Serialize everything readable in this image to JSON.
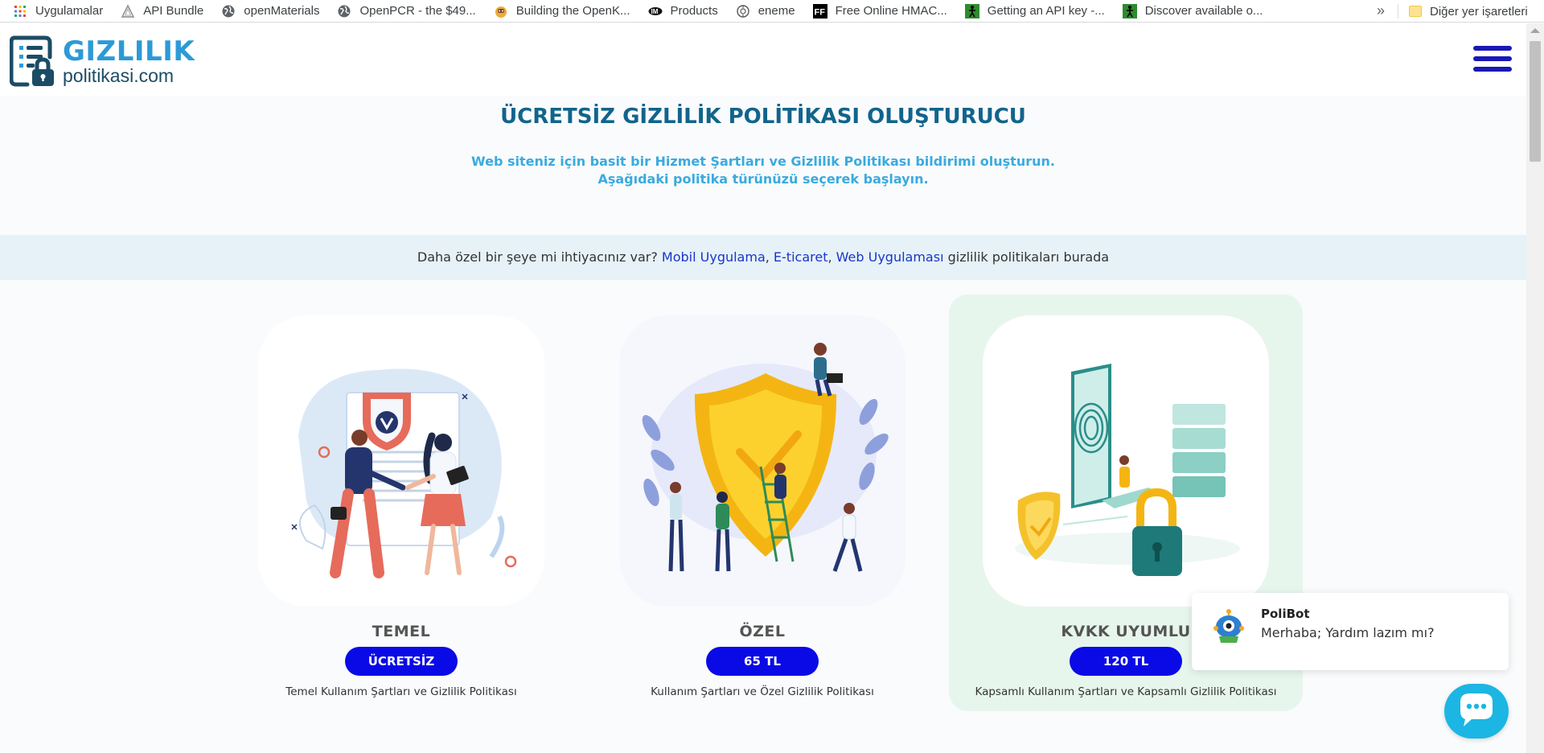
{
  "bookmarks": {
    "items": [
      {
        "label": "Uygulamalar",
        "icon": "apps-grid-icon"
      },
      {
        "label": "API Bundle",
        "icon": "triangle-logo-icon"
      },
      {
        "label": "openMaterials",
        "icon": "globe-icon"
      },
      {
        "label": "OpenPCR - the $49...",
        "icon": "globe-icon"
      },
      {
        "label": "Building the OpenK...",
        "icon": "maker-logo-icon"
      },
      {
        "label": "Products",
        "icon": "nordic-logo-icon"
      },
      {
        "label": "eneme",
        "icon": "eneme-logo-icon"
      },
      {
        "label": "Free Online HMAC...",
        "icon": "ff-logo-icon"
      },
      {
        "label": "Getting an API key -...",
        "icon": "green-figure-icon"
      },
      {
        "label": "Discover available o...",
        "icon": "green-figure-icon"
      }
    ],
    "more": "»",
    "other": "Diğer yer işaretleri"
  },
  "header": {
    "logo_line1": "GIZLILIK",
    "logo_line2": "politikasi.com"
  },
  "hero": {
    "title": "ÜCRETSİZ GİZLİLİK POLİTİKASI OLUŞTURUCU",
    "subtitle_line1": "Web siteniz için basit bir Hizmet Şartları ve Gizlilik Politikası bildirimi oluşturun.",
    "subtitle_line2": "Aşağıdaki politika türünüzü seçerek başlayın."
  },
  "band": {
    "prefix": "Daha özel bir şeye mi ihtiyacınız var? ",
    "link1": "Mobil Uygulama",
    "sep1": ", ",
    "link2": "E-ticaret",
    "sep2": ", ",
    "link3": "Web Uygulaması",
    "suffix": " gizlilik politikaları burada"
  },
  "plans": [
    {
      "name": "TEMEL",
      "price": "ÜCRETSİZ",
      "desc": "Temel Kullanım Şartları ve Gizlilik Politikası"
    },
    {
      "name": "ÖZEL",
      "price": "65 TL",
      "desc": "Kullanım Şartları ve Özel Gizlilik Politikası"
    },
    {
      "name": "KVKK UYUMLU",
      "price": "120 TL",
      "desc": "Kapsamlı Kullanım Şartları ve Kapsamlı Gizlilik Politikası"
    }
  ],
  "chat": {
    "bot_name": "PoliBot",
    "message": "Merhaba; Yardım lazım mı?"
  },
  "colors": {
    "brand_blue": "#2c9ad7",
    "title_teal": "#11648c",
    "button_blue": "#0a0ae6",
    "highlight_green": "#e7f6ed",
    "chat_cyan": "#1bb6e3"
  }
}
